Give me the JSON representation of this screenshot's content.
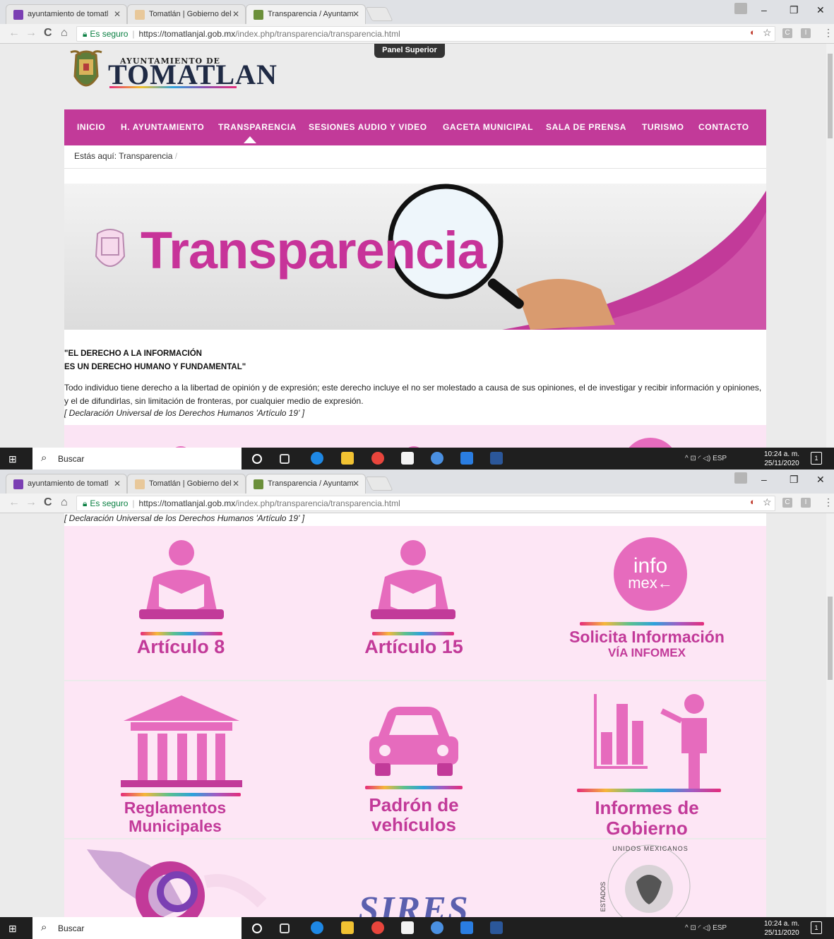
{
  "browser": {
    "tabs": [
      {
        "label": "ayuntamiento de tomatl",
        "close": "✕"
      },
      {
        "label": "Tomatlán | Gobierno del",
        "close": "✕"
      },
      {
        "label": "Transparencia / Ayuntam",
        "close": "✕"
      }
    ],
    "window_controls": {
      "minimize": "–",
      "restore": "❐",
      "close": "✕"
    },
    "nav": {
      "back": "←",
      "forward": "→",
      "reload": "C",
      "home": "⌂"
    },
    "address": {
      "secure_label": "Es seguro",
      "host": "https://tomatlanjal.gob.mx",
      "path": "/index.php/transparencia/transparencia.html"
    }
  },
  "site": {
    "logo_small": "AYUNTAMIENTO DE",
    "logo_big": "TOMATLAN",
    "panel_superior": "Panel Superior",
    "menu": [
      "INICIO",
      "H. AYUNTAMIENTO",
      "TRANSPARENCIA",
      "SESIONES AUDIO Y VIDEO",
      "GACETA MUNICIPAL",
      "SALA DE PRENSA",
      "TURISMO",
      "CONTACTO"
    ],
    "breadcrumb_prefix": "Estás aquí:",
    "breadcrumb_current": "Transparencia",
    "breadcrumb_sep": "/",
    "banner_word": "Transparencia",
    "quote_line1": "\"EL DERECHO A LA INFORMACIÓN",
    "quote_line2": "ES UN DERECHO HUMANO Y FUNDAMENTAL\"",
    "paragraph": "Todo individuo tiene derecho a la libertad de opinión y de expresión; este derecho incluye el no ser molestado a causa de sus opiniones, el de investigar y recibir información y opiniones, y el de difundirlas, sin limitación de fronteras, por cualquier medio de expresión.",
    "citation": "[ Declaración Universal de los Derechos Humanos 'Artículo 19' ]",
    "cards": {
      "art8": "Artículo 8",
      "art15": "Artículo 15",
      "infomex_logo_1": "info",
      "infomex_logo_2": "mex←",
      "solicita_1": "Solicita Información",
      "solicita_2": "VÍA INFOMEX",
      "reglamentos_1": "Reglamentos",
      "reglamentos_2": "Municipales",
      "padron_1": "Padrón de",
      "padron_2": "vehículos",
      "informes_1": "Informes de",
      "informes_2": "Gobierno",
      "sires": "SIRES",
      "seal_text": "UNIDOS MEXICANOS",
      "seal_text_left": "ESTADOS"
    }
  },
  "taskbar": {
    "search_placeholder": "Buscar",
    "tray": "^  ⊡  ◜  ◁)  ESP",
    "time": "10:24 a. m.",
    "date": "25/11/2020",
    "notif": "1"
  },
  "colors": {
    "brand_magenta": "#c23a99",
    "pink_bg": "#fde6f5",
    "taskbar": "#1f1f1f"
  }
}
